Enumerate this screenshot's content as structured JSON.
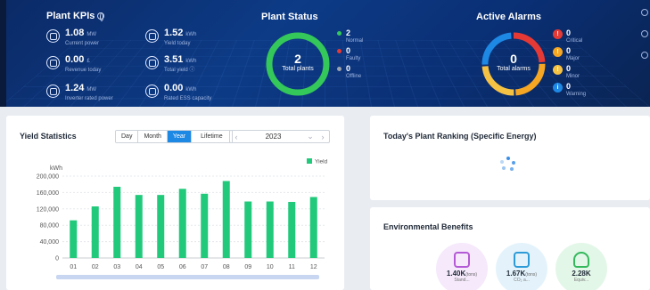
{
  "plant_kpis": {
    "title": "Plant KPIs",
    "items": [
      {
        "icon": "power-icon",
        "value": "1.08",
        "unit": "MW",
        "label": "Current power"
      },
      {
        "icon": "yield-icon",
        "value": "1.52",
        "unit": "kWh",
        "label": "Yield today"
      },
      {
        "icon": "revenue-icon",
        "value": "0.00",
        "unit": "£",
        "label": "Revenue today"
      },
      {
        "icon": "total-yield-icon",
        "value": "3.51",
        "unit": "kWh",
        "label": "Total yield ⓘ"
      },
      {
        "icon": "inverter-icon",
        "value": "1.24",
        "unit": "MW",
        "label": "Inverter rated power"
      },
      {
        "icon": "ess-icon",
        "value": "0.00",
        "unit": "kWh",
        "label": "Rated ESS capacity"
      }
    ]
  },
  "plant_status": {
    "title": "Plant Status",
    "total_value": "2",
    "total_label": "Total plants",
    "legend": [
      {
        "value": "2",
        "label": "Normal",
        "color": "#34c759"
      },
      {
        "value": "0",
        "label": "Faulty",
        "color": "#e53935"
      },
      {
        "value": "0",
        "label": "Offline",
        "color": "#9aa3ad"
      }
    ]
  },
  "active_alarms": {
    "title": "Active Alarms",
    "total_value": "0",
    "total_label": "Total alarms",
    "ring_colors": [
      "#e53935",
      "#f5a623",
      "#f6c244",
      "#1e88e5"
    ],
    "legend": [
      {
        "value": "0",
        "label": "Critical",
        "color": "#e53935",
        "glyph": "!"
      },
      {
        "value": "0",
        "label": "Major",
        "color": "#f5a623",
        "glyph": "!"
      },
      {
        "value": "0",
        "label": "Minor",
        "color": "#f6c244",
        "glyph": "!"
      },
      {
        "value": "0",
        "label": "Warning",
        "color": "#1e88e5",
        "glyph": "i"
      }
    ]
  },
  "yield_statistics": {
    "title": "Yield Statistics",
    "periods": [
      "Day",
      "Month",
      "Year",
      "Lifetime"
    ],
    "active_period": "Year",
    "year": "2023",
    "prev_icon": "chevron-left-icon",
    "next_icon": "chevron-right-icon",
    "dropdown_icon": "chevron-down-icon"
  },
  "chart_data": {
    "type": "bar",
    "ylabel": "kWh",
    "categories": [
      "01",
      "02",
      "03",
      "04",
      "05",
      "06",
      "07",
      "08",
      "09",
      "10",
      "11",
      "12"
    ],
    "series": [
      {
        "name": "Yield",
        "color": "#21c97a",
        "values": [
          92000,
          126000,
          174000,
          154000,
          154000,
          169000,
          157000,
          188000,
          138000,
          138000,
          137000,
          149000
        ]
      }
    ],
    "yticks": [
      "0",
      "40,000",
      "80,000",
      "120,000",
      "160,000",
      "200,000"
    ],
    "ylim": [
      0,
      200000
    ],
    "grid": true,
    "legend_position": "top-right"
  },
  "ranking": {
    "title": "Today's Plant Ranking (Specific Energy)"
  },
  "environmental": {
    "title": "Environmental Benefits",
    "items": [
      {
        "icon": "coal-icon",
        "value": "1.40K",
        "unit": "(tons)",
        "label": "Stand...",
        "bg": "#f5e9fb",
        "color": "#b45ad6"
      },
      {
        "icon": "co2-icon",
        "value": "1.67K",
        "unit": "(tons)",
        "label": "CO₂ a...",
        "bg": "#e4f3fb",
        "color": "#2d9bd8"
      },
      {
        "icon": "tree-icon",
        "value": "2.28K",
        "unit": "",
        "label": "Equiv...",
        "bg": "#e3f7e8",
        "color": "#34b85c"
      }
    ]
  }
}
